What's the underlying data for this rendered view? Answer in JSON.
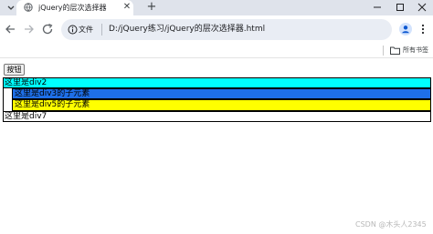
{
  "browser": {
    "tab_title": "jQuery的层次选择器",
    "new_tab_glyph": "+",
    "close_glyph": "✕",
    "file_chip_label": "文件",
    "url": "D:/jQuery练习/jQuery的层次选择器.html",
    "bookmarks_label": "所有书签"
  },
  "page": {
    "button_label": "按钮",
    "div2_text": "这里是div2",
    "div3_child_text": "这里是div3的子元素",
    "div5_child_text": "这里是div5的子元素",
    "div7_text": "这里是div7"
  },
  "watermark": "CSDN @木头人2345",
  "colors": {
    "div2_bg": "#00ffff",
    "div3_child_bg": "#1e6fe8",
    "div5_child_bg": "#ffff00",
    "tab_strip_bg": "#dfe3eb"
  }
}
